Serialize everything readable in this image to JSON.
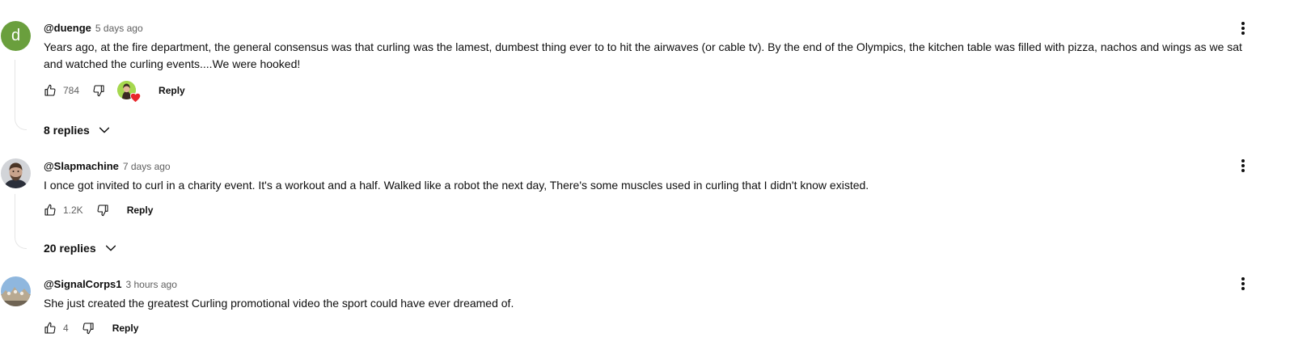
{
  "colors": {
    "text_primary": "#0f0f0f",
    "text_secondary": "#606060",
    "avatar_letter_bg": "#6a9f3d",
    "heart": "#e8262b"
  },
  "comments": [
    {
      "avatar_letter": "d",
      "author": "@duenge",
      "time": "5 days ago",
      "text": "Years ago, at the fire department, the general consensus was that curling was the lamest, dumbest thing ever to to hit the airwaves (or cable tv).  By the end of the Olympics, the kitchen table was filled with pizza, nachos and wings as we sat and watched the curling events....We were hooked!",
      "likes": "784",
      "creator_heart": true,
      "reply_label": "Reply",
      "replies_label": "8 replies",
      "icons": [
        "thumb-up-icon",
        "thumb-down-icon",
        "creator-heart-icon",
        "chevron-down-icon",
        "more-vert-icon"
      ]
    },
    {
      "author": "@Slapmachine",
      "time": "7 days ago",
      "text": "I once got invited to curl in a charity event. It's a workout and a half. Walked like a robot the next day, There's some muscles used in curling that I didn't know existed.",
      "likes": "1.2K",
      "creator_heart": false,
      "reply_label": "Reply",
      "replies_label": "20 replies"
    },
    {
      "author": "@SignalCorps1",
      "time": "3 hours ago",
      "text": "She just created the greatest Curling promotional video the sport could have ever dreamed of.",
      "likes": "4",
      "creator_heart": false,
      "reply_label": "Reply"
    }
  ]
}
